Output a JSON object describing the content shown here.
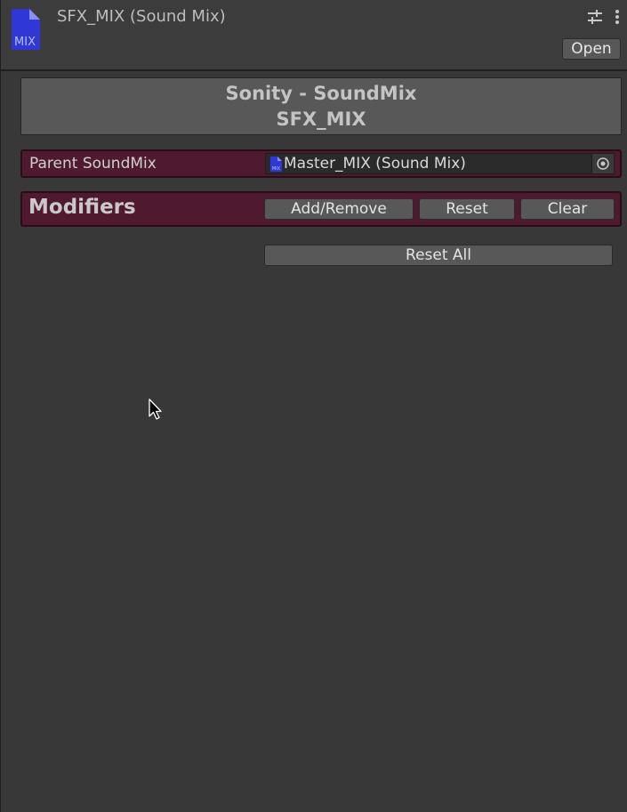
{
  "header": {
    "asset_icon_label": "MIX",
    "title": "SFX_MIX (Sound Mix)",
    "open_button_label": "Open"
  },
  "banner": {
    "line1": "Sonity - SoundMix",
    "line2": "SFX_MIX"
  },
  "parent": {
    "label": "Parent SoundMix",
    "value": "Master_MIX (Sound Mix)",
    "icon_label": "MIX"
  },
  "modifiers": {
    "title": "Modifiers",
    "add_remove_label": "Add/Remove",
    "reset_label": "Reset",
    "clear_label": "Clear"
  },
  "reset_all_label": "Reset All",
  "colors": {
    "background": "#383838",
    "section_accent": "#4f1a30",
    "button": "#585858",
    "asset_icon_blue": "#2f37d6"
  }
}
